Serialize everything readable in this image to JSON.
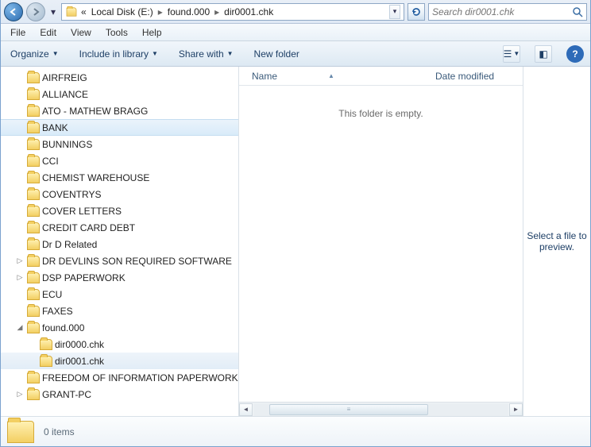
{
  "breadcrumb": {
    "prefix": "«",
    "seg1": "Local Disk (E:)",
    "seg2": "found.000",
    "seg3": "dir0001.chk"
  },
  "search": {
    "placeholder": "Search dir0001.chk"
  },
  "menu": {
    "file": "File",
    "edit": "Edit",
    "view": "View",
    "tools": "Tools",
    "help": "Help"
  },
  "toolbar": {
    "organize": "Organize",
    "include": "Include in library",
    "share": "Share with",
    "newfolder": "New folder"
  },
  "tree": {
    "items": [
      {
        "label": "AIRFREIG",
        "depth": 0,
        "exp": ""
      },
      {
        "label": "ALLIANCE",
        "depth": 0,
        "exp": ""
      },
      {
        "label": "ATO - MATHEW BRAGG",
        "depth": 0,
        "exp": ""
      },
      {
        "label": "BANK",
        "depth": 0,
        "exp": "",
        "selected": true
      },
      {
        "label": "BUNNINGS",
        "depth": 0,
        "exp": ""
      },
      {
        "label": "CCI",
        "depth": 0,
        "exp": ""
      },
      {
        "label": "CHEMIST WAREHOUSE",
        "depth": 0,
        "exp": ""
      },
      {
        "label": "COVENTRYS",
        "depth": 0,
        "exp": ""
      },
      {
        "label": "COVER LETTERS",
        "depth": 0,
        "exp": ""
      },
      {
        "label": "CREDIT CARD DEBT",
        "depth": 0,
        "exp": ""
      },
      {
        "label": "Dr D Related",
        "depth": 0,
        "exp": ""
      },
      {
        "label": "DR DEVLINS SON REQUIRED SOFTWARE",
        "depth": 0,
        "exp": "▷"
      },
      {
        "label": "DSP PAPERWORK",
        "depth": 0,
        "exp": "▷"
      },
      {
        "label": "ECU",
        "depth": 0,
        "exp": ""
      },
      {
        "label": "FAXES",
        "depth": 0,
        "exp": ""
      },
      {
        "label": "found.000",
        "depth": 0,
        "exp": "◢",
        "open": true
      },
      {
        "label": "dir0000.chk",
        "depth": 1,
        "exp": ""
      },
      {
        "label": "dir0001.chk",
        "depth": 1,
        "exp": "",
        "current": true
      },
      {
        "label": "FREEDOM OF INFORMATION PAPERWORK",
        "depth": 0,
        "exp": ""
      },
      {
        "label": "GRANT-PC",
        "depth": 0,
        "exp": "▷"
      }
    ]
  },
  "columns": {
    "name": "Name",
    "date": "Date modified"
  },
  "emptymsg": "This folder is empty.",
  "preview": {
    "text": "Select a file to preview."
  },
  "status": {
    "count": "0 items"
  }
}
